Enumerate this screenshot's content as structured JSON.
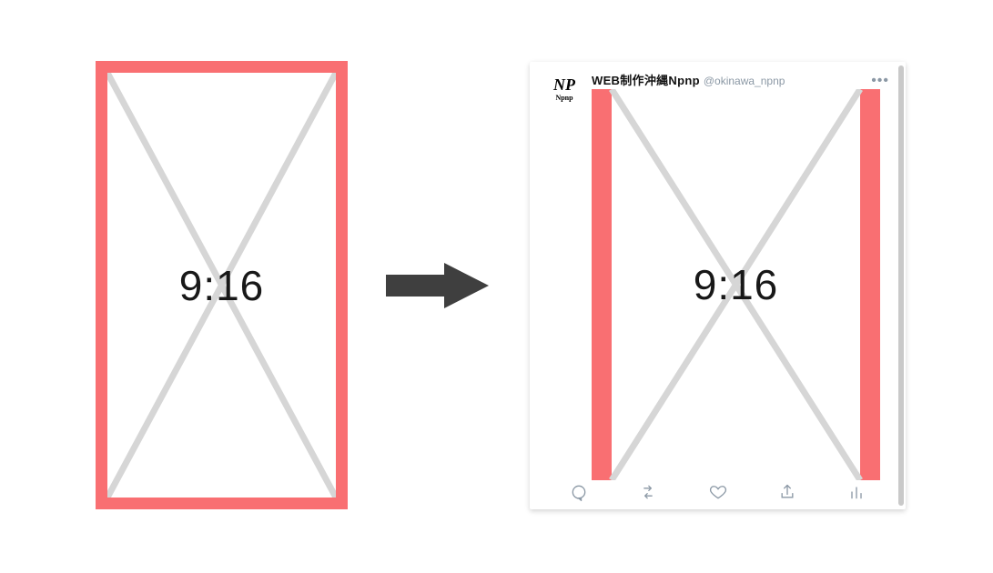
{
  "diagram": {
    "aspect_ratio_label": "9:16",
    "frame_color": "#f96f72",
    "cross_color": "#d6d6d6"
  },
  "tweet": {
    "avatar": {
      "top": "NP",
      "bottom": "Npnp"
    },
    "display_name": "WEB制作沖縄Npnp",
    "handle": "@okinawa_npnp",
    "image_aspect_label": "9:16",
    "letterbox_color": "#f96f72"
  },
  "icons": {
    "arrow": "arrow-right-icon",
    "more": "more-icon",
    "reply": "reply-icon",
    "retweet": "retweet-icon",
    "like": "like-icon",
    "share": "share-icon",
    "analytics": "analytics-icon"
  }
}
